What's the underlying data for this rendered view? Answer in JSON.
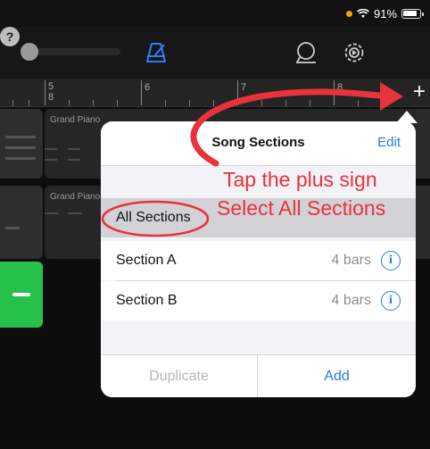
{
  "status_bar": {
    "battery_text": "91%"
  },
  "toolbar": {
    "icons": [
      "metronome-icon",
      "loop-icon",
      "settings-icon",
      "help-icon"
    ],
    "help_label": "?"
  },
  "ruler": {
    "bar_numbers": [
      "5",
      "6",
      "7",
      "8"
    ],
    "sub_label": "8",
    "add_label": "+"
  },
  "tracks": {
    "region_labels": [
      "Grand Piano",
      "Grand Piano"
    ]
  },
  "popover": {
    "title": "Song Sections",
    "edit_label": "Edit",
    "all_sections_label": "All Sections",
    "sections": [
      {
        "name": "Section A",
        "length": "4 bars"
      },
      {
        "name": "Section B",
        "length": "4 bars"
      }
    ],
    "info_glyph": "i",
    "duplicate_label": "Duplicate",
    "add_label": "Add"
  },
  "annotation": {
    "line1": "Tap the plus sign",
    "line2": "Select All Sections",
    "color": "#e8323c"
  },
  "colors": {
    "accent_blue": "#1f7cf0",
    "track_green": "#26c04a",
    "battery_dot": "#f2a20b"
  }
}
